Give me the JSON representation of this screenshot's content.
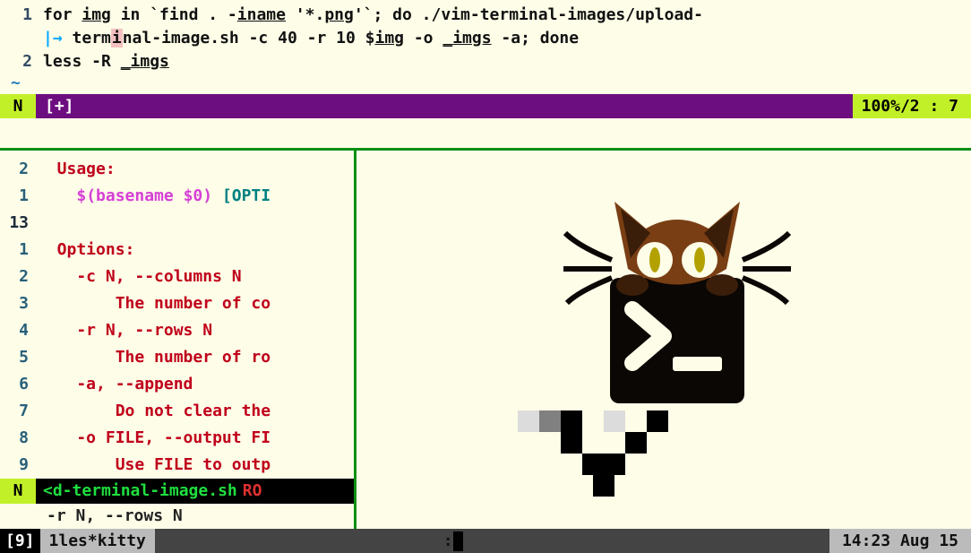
{
  "top": {
    "lines": [
      {
        "n": "1",
        "segments": [
          {
            "t": "for "
          },
          {
            "t": "img",
            "u": true
          },
          {
            "t": " in `find . -"
          },
          {
            "t": "iname",
            "u": true
          },
          {
            "t": " '*."
          },
          {
            "t": "png",
            "u": true
          },
          {
            "t": "'`; do ./vim-terminal-images/upload-"
          }
        ]
      },
      {
        "n": "",
        "wrap": true,
        "segments": [
          {
            "t": "term"
          },
          {
            "t": "i",
            "cursor": true
          },
          {
            "t": "nal-image.sh -c 40 -r 10 $"
          },
          {
            "t": "img",
            "u": true
          },
          {
            "t": " -o "
          },
          {
            "t": "_",
            "u": true
          },
          {
            "t": "imgs",
            "u": true
          },
          {
            "t": " -a; done"
          }
        ]
      },
      {
        "n": "2",
        "segments": [
          {
            "t": "less -R "
          },
          {
            "t": "_",
            "u": true
          },
          {
            "t": "imgs",
            "u": true
          }
        ]
      }
    ],
    "tilde": "~"
  },
  "status_top": {
    "mode": "N",
    "modified": "[+]",
    "pos": "100%/2 : 7"
  },
  "help": {
    "lines": [
      {
        "n": "2",
        "cls": "red",
        "indent": "  ",
        "text": "Usage:"
      },
      {
        "n": "1",
        "cls": "",
        "indent": "    ",
        "parts": [
          {
            "t": "$(basename $0)",
            "cls": "magenta"
          },
          {
            "t": " [OPTI",
            "cls": "teal"
          }
        ]
      },
      {
        "n": "13",
        "cls": "",
        "indent": "",
        "text": "",
        "cur": true
      },
      {
        "n": "1",
        "cls": "red",
        "indent": "  ",
        "text": "Options:"
      },
      {
        "n": "2",
        "cls": "red",
        "indent": "    ",
        "text": "-c N, --columns N"
      },
      {
        "n": "3",
        "cls": "red",
        "indent": "        ",
        "text": "The number of co"
      },
      {
        "n": "4",
        "cls": "red",
        "indent": "    ",
        "text": "-r N, --rows N"
      },
      {
        "n": "5",
        "cls": "red",
        "indent": "        ",
        "text": "The number of ro"
      },
      {
        "n": "6",
        "cls": "red",
        "indent": "    ",
        "text": "-a, --append"
      },
      {
        "n": "7",
        "cls": "red",
        "indent": "        ",
        "text": "Do not clear the"
      },
      {
        "n": "8",
        "cls": "red",
        "indent": "    ",
        "text": "-o FILE, --output FI"
      },
      {
        "n": "9",
        "cls": "red",
        "indent": "        ",
        "text": "Use FILE to outp"
      }
    ]
  },
  "status_bottom_left": {
    "mode": "N",
    "file": "<d-terminal-image.sh",
    "ro": "RO"
  },
  "cmdline_left": "-r N, --rows N",
  "cmdline_right": ":",
  "tmux": {
    "session": "[9]",
    "window": "1les*kitty",
    "clock": "14:23 Aug 15"
  }
}
